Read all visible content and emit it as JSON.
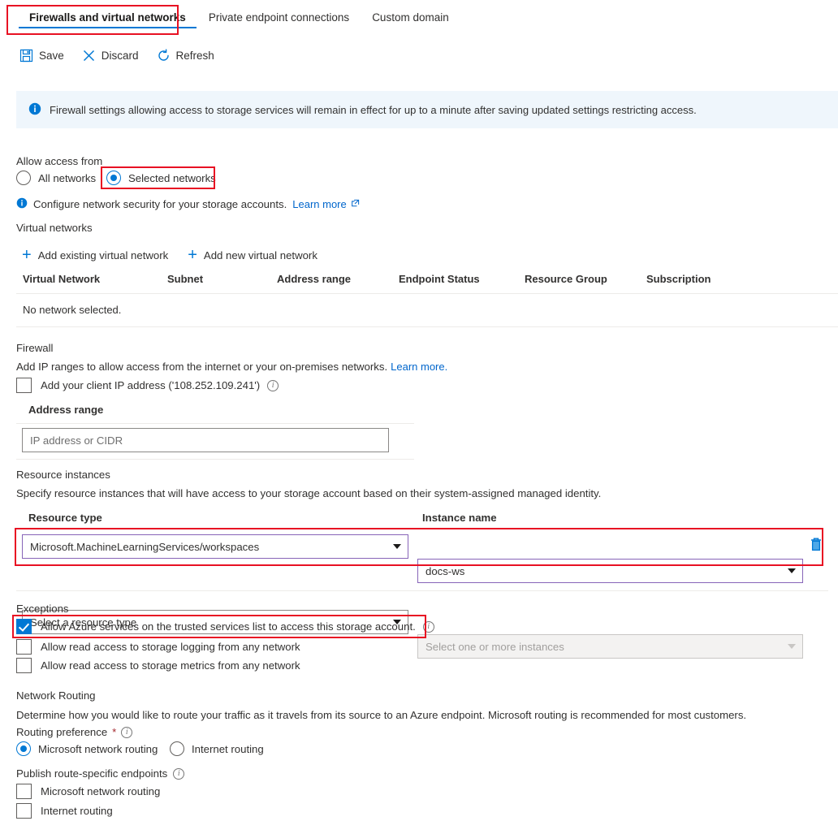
{
  "tabs": [
    {
      "label": "Firewalls and virtual networks",
      "active": true
    },
    {
      "label": "Private endpoint connections",
      "active": false
    },
    {
      "label": "Custom domain",
      "active": false
    }
  ],
  "commandbar": {
    "save": "Save",
    "discard": "Discard",
    "refresh": "Refresh"
  },
  "banner": {
    "text": "Firewall settings allowing access to storage services will remain in effect for up to a minute after saving updated settings restricting access."
  },
  "access": {
    "section_label": "Allow access from",
    "option_all": "All networks",
    "option_selected": "Selected networks",
    "selected_value": "Selected networks",
    "hint_text": "Configure network security for your storage accounts.",
    "hint_link": "Learn more"
  },
  "virtual_networks": {
    "section_label": "Virtual networks",
    "add_existing": "Add existing virtual network",
    "add_new": "Add new virtual network",
    "columns": [
      "Virtual Network",
      "Subnet",
      "Address range",
      "Endpoint Status",
      "Resource Group",
      "Subscription"
    ],
    "empty_text": "No network selected."
  },
  "firewall": {
    "section_label": "Firewall",
    "description": "Add IP ranges to allow access from the internet or your on-premises networks.",
    "description_link": "Learn more.",
    "client_ip_label": "Add your client IP address ('108.252.109.241')",
    "client_ip_checked": false,
    "address_range_label": "Address range",
    "address_range_value": "",
    "address_range_placeholder": "IP address or CIDR"
  },
  "resource_instances": {
    "section_label": "Resource instances",
    "description": "Specify resource instances that will have access to your storage account based on their system-assigned managed identity.",
    "col_resource_type": "Resource type",
    "col_instance_name": "Instance name",
    "rows": [
      {
        "resource_type": "Microsoft.MachineLearningServices/workspaces",
        "instance_name": "docs-ws",
        "disabled": false,
        "highlighted": true
      },
      {
        "resource_type": "Select a resource type",
        "instance_name": "Select one or more instances",
        "disabled": true,
        "highlighted": false
      }
    ]
  },
  "exceptions": {
    "section_label": "Exceptions",
    "items": [
      {
        "label": "Allow Azure services on the trusted services list to access this storage account.",
        "checked": true,
        "has_info": true
      },
      {
        "label": "Allow read access to storage logging from any network",
        "checked": false,
        "has_info": false
      },
      {
        "label": "Allow read access to storage metrics from any network",
        "checked": false,
        "has_info": false
      }
    ]
  },
  "network_routing": {
    "section_label": "Network Routing",
    "description": "Determine how you would like to route your traffic as it travels from its source to an Azure endpoint. Microsoft routing is recommended for most customers.",
    "routing_preference_label": "Routing preference",
    "required_mark": "*",
    "option_microsoft": "Microsoft network routing",
    "option_internet": "Internet routing",
    "selected_preference": "Microsoft network routing",
    "publish_label": "Publish route-specific endpoints",
    "publish_items": [
      {
        "label": "Microsoft network routing",
        "checked": false
      },
      {
        "label": "Internet routing",
        "checked": false
      }
    ]
  },
  "icons": {
    "save": "save-disk-icon",
    "discard": "x-cross-icon",
    "refresh": "circular-arrow-icon",
    "info_banner": "info-filled-icon",
    "info_hint": "info-filled-icon",
    "external_link": "external-link-icon",
    "delete": "trash-can-icon",
    "add": "plus-icon",
    "info_outline": "info-outline-icon",
    "chevron": "chevron-down-icon"
  },
  "colors": {
    "accent": "#0078d4",
    "link": "#0066cc",
    "annotation": "#e81123",
    "focus_border": "#8764b8",
    "banner_bg": "#eff6fc",
    "required": "#a4262c"
  }
}
